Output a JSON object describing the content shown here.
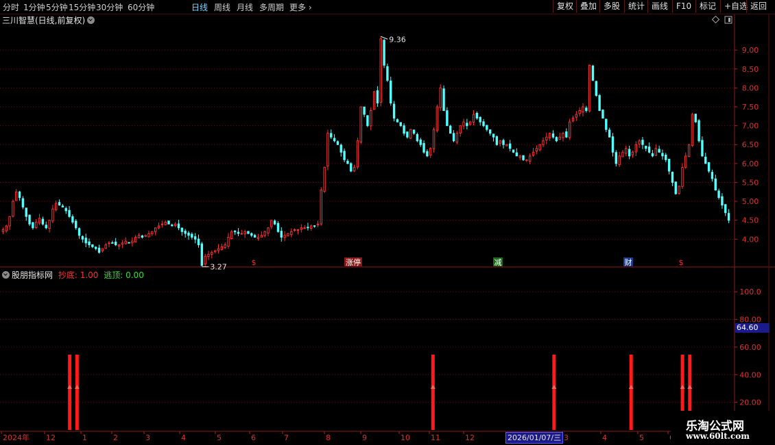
{
  "toolbar": {
    "periods": [
      "分时",
      "1分钟",
      "5分钟",
      "15分钟",
      "30分钟",
      "60分钟",
      "日线",
      "周线",
      "月线",
      "多周期",
      "更多"
    ],
    "active_period": "日线",
    "buttons": [
      "复权",
      "叠加",
      "多股",
      "统计",
      "画线",
      "F10",
      "标记",
      "+自选",
      "返回"
    ]
  },
  "price_panel": {
    "title": "三川智慧(日线,前复权)",
    "high_label": "9.36",
    "low_label": "3.27",
    "yticks": [
      "9.00",
      "8.50",
      "8.00",
      "7.50",
      "7.00",
      "6.50",
      "6.00",
      "5.50",
      "5.00",
      "4.50",
      "4.00"
    ],
    "event_marks": [
      {
        "text": "$",
        "color": "#ff3030"
      },
      {
        "text": "涨停",
        "color": "#ffffff",
        "bg": "#8a1a1a"
      },
      {
        "text": "减",
        "color": "#ffffff",
        "bg": "#1a6a1a"
      },
      {
        "text": "财",
        "color": "#ffffff",
        "bg": "#1a3a8a"
      },
      {
        "text": "$",
        "color": "#ff3030"
      }
    ]
  },
  "indicator_panel": {
    "title": "股朋指标网",
    "buy_label": "抄底: 1.00",
    "escape_label": "逃顶: 0.00",
    "buy_color": "#ff3030",
    "escape_color": "#30e030",
    "yticks": [
      "100.0",
      "80.00",
      "60.00",
      "40.00",
      "20.00"
    ],
    "current_value": "64.60"
  },
  "xaxis": {
    "labels": [
      "2024年",
      "12",
      "1",
      "2",
      "3",
      "4",
      "5",
      "6",
      "7",
      "8",
      "9",
      "10",
      "11",
      "12",
      "3",
      "4",
      "5",
      "6"
    ],
    "selected_date": "2026/01/07/三"
  },
  "watermark": {
    "title": "乐淘公式网",
    "url": "www.60lt.com"
  },
  "chart_data": {
    "type": "candlestick",
    "title": "三川智慧(日线,前复权)",
    "ylim": [
      3.3,
      9.6
    ],
    "close_series": [
      4.25,
      4.35,
      4.6,
      5.0,
      5.25,
      5.1,
      4.85,
      4.6,
      4.4,
      4.3,
      4.45,
      4.55,
      4.4,
      4.3,
      4.5,
      4.8,
      4.95,
      4.9,
      4.85,
      4.75,
      4.6,
      4.45,
      4.3,
      4.1,
      4.0,
      3.9,
      3.85,
      3.8,
      3.75,
      3.65,
      3.75,
      3.85,
      3.9,
      3.9,
      3.85,
      3.85,
      3.9,
      3.95,
      3.9,
      3.95,
      4.05,
      4.1,
      4.05,
      4.1,
      4.15,
      4.2,
      4.3,
      4.35,
      4.4,
      4.45,
      4.4,
      4.35,
      4.4,
      4.3,
      4.2,
      4.15,
      4.1,
      4.05,
      4.0,
      3.85,
      3.3,
      3.55,
      3.6,
      3.65,
      3.7,
      3.75,
      3.8,
      3.85,
      4.05,
      4.2,
      4.2,
      4.15,
      4.15,
      4.2,
      4.15,
      4.1,
      4.05,
      4.05,
      4.1,
      4.2,
      4.3,
      4.5,
      4.4,
      4.2,
      4.05,
      4.1,
      4.15,
      4.2,
      4.25,
      4.25,
      4.3,
      4.3,
      4.3,
      4.35,
      4.35,
      4.4,
      5.3,
      5.9,
      6.8,
      6.7,
      6.6,
      6.5,
      6.3,
      6.1,
      6.0,
      5.8,
      5.9,
      6.6,
      7.5,
      7.3,
      7.0,
      7.4,
      7.9,
      7.6,
      9.3,
      8.6,
      8.2,
      7.6,
      7.2,
      7.1,
      7.0,
      6.8,
      6.7,
      6.9,
      6.8,
      6.6,
      6.5,
      6.3,
      6.2,
      6.4,
      6.9,
      7.5,
      8.0,
      7.4,
      7.0,
      6.8,
      6.6,
      6.8,
      7.0,
      7.1,
      7.0,
      7.1,
      7.3,
      7.2,
      7.1,
      7.0,
      6.9,
      6.8,
      6.7,
      6.5,
      6.6,
      6.5,
      6.5,
      6.4,
      6.3,
      6.2,
      6.2,
      6.1,
      6.1,
      6.2,
      6.3,
      6.4,
      6.5,
      6.6,
      6.7,
      6.8,
      6.7,
      6.6,
      6.7,
      6.8,
      6.7,
      7.1,
      7.2,
      7.3,
      7.4,
      7.5,
      7.4,
      8.6,
      8.2,
      7.8,
      7.4,
      7.2,
      6.9,
      6.7,
      6.3,
      6.0,
      6.2,
      6.3,
      6.4,
      6.2,
      6.3,
      6.5,
      6.6,
      6.5,
      6.4,
      6.3,
      6.2,
      6.4,
      6.3,
      6.2,
      6.1,
      5.8,
      5.5,
      5.2,
      5.4,
      5.9,
      6.2,
      6.5,
      7.3,
      7.1,
      6.6,
      6.2,
      6.0,
      5.8,
      5.6,
      5.3,
      5.1,
      4.9,
      4.7,
      4.5
    ]
  },
  "indicator_data": {
    "signal_positions": [
      0.095,
      0.105,
      0.59,
      0.755,
      0.86,
      0.93,
      0.94
    ]
  }
}
